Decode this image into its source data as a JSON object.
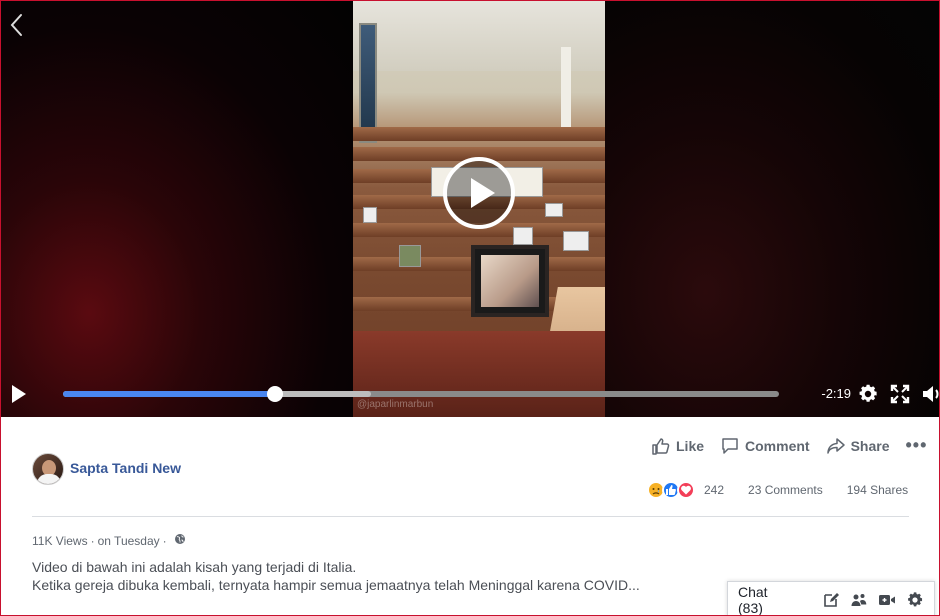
{
  "video": {
    "watermark": "@japarlinmarbun",
    "time_remaining": "-2:19",
    "progress_played": 0.296,
    "progress_buffered": 0.43
  },
  "post": {
    "author": "Sapta Tandi New",
    "actions": {
      "like": "Like",
      "comment": "Comment",
      "share": "Share",
      "more": "•••"
    },
    "stats": {
      "reactions": "242",
      "comments": "23 Comments",
      "shares": "194 Shares",
      "reaction_types": [
        "sad-icon",
        "like-icon",
        "love-icon"
      ]
    },
    "meta": {
      "views": "11K Views",
      "separator": "·",
      "date": "on Tuesday",
      "privacy_icon": "globe-icon"
    },
    "description": {
      "line1": "Video di bawah ini adalah kisah yang terjadi di Italia.",
      "line2": "Ketika gereja dibuka kembali, ternyata hampir semua jemaatnya telah Meninggal karena COVID..."
    }
  },
  "chat": {
    "label": "Chat (83)",
    "icons": [
      "compose-icon",
      "group-icon",
      "video-call-icon",
      "gear-icon"
    ]
  },
  "colors": {
    "accent": "#4a86f0",
    "link": "#385898",
    "frame_border": "#c8102e"
  }
}
